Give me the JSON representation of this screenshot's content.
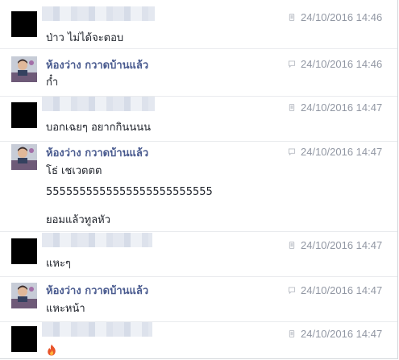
{
  "messages": [
    {
      "sender": "",
      "avatar": "black-square",
      "sender_hidden": true,
      "timestamp": "24/10/2016 14:46",
      "status_icon": "mobile-icon",
      "lines": [
        "ป่าว ไม่ได้จะตอบ"
      ]
    },
    {
      "sender": "ห้องว่าง กวาดบ้านแล้ว",
      "avatar": "profile-photo",
      "sender_hidden": false,
      "timestamp": "24/10/2016 14:46",
      "status_icon": "chat-bubble-icon",
      "lines": [
        "ก๋ำ"
      ]
    },
    {
      "sender": "",
      "avatar": "black-square",
      "sender_hidden": true,
      "timestamp": "24/10/2016 14:47",
      "status_icon": "mobile-icon",
      "lines": [
        "บอกเฉยๆ อยากกินนนน"
      ]
    },
    {
      "sender": "ห้องว่าง กวาดบ้านแล้ว",
      "avatar": "profile-photo",
      "sender_hidden": false,
      "timestamp": "24/10/2016 14:47",
      "status_icon": "chat-bubble-icon",
      "lines": [
        "โธ่ เชเวตตต",
        "5555555555555555555555555",
        "ยอมแล้วทูลหัว"
      ]
    },
    {
      "sender": "",
      "avatar": "black-square",
      "sender_hidden": true,
      "timestamp": "24/10/2016 14:47",
      "status_icon": "mobile-icon",
      "lines": [
        "แหะๆ"
      ]
    },
    {
      "sender": "ห้องว่าง กวาดบ้านแล้ว",
      "avatar": "profile-photo",
      "sender_hidden": false,
      "timestamp": "24/10/2016 14:47",
      "status_icon": "chat-bubble-icon",
      "lines": [
        "แหะหน้า"
      ]
    },
    {
      "sender": "",
      "avatar": "black-square",
      "sender_hidden": true,
      "timestamp": "24/10/2016 14:47",
      "status_icon": "mobile-icon",
      "lines": [],
      "emoji": "fire-emoji-icon"
    }
  ],
  "colors": {
    "sender_name": "#4b5c90",
    "timestamp": "#9197a3",
    "message_text": "#1d2129",
    "divider": "#e9ebee"
  }
}
